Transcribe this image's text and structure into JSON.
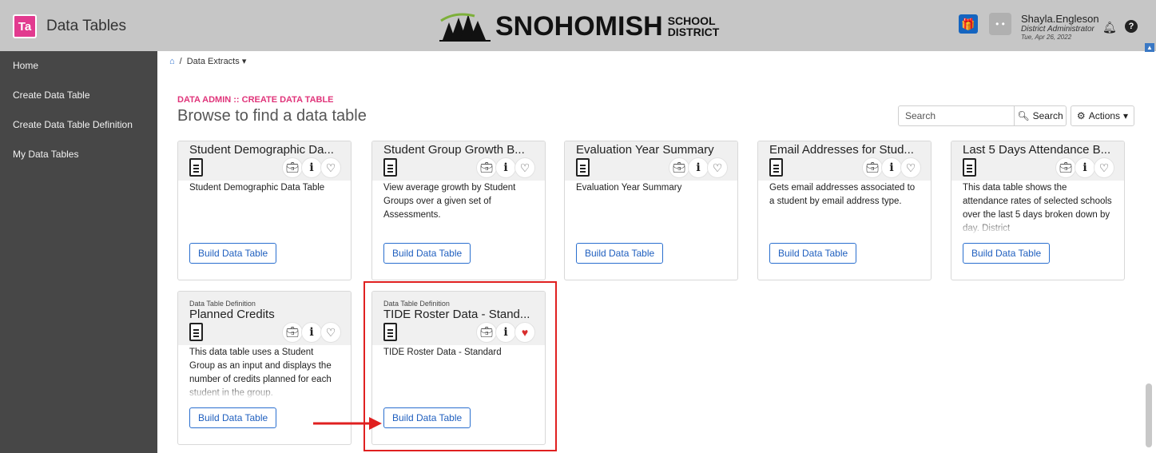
{
  "app": {
    "logo_text": "Ta",
    "name": "Data Tables"
  },
  "district": {
    "name": "SNOHOMISH",
    "line1": "SCHOOL",
    "line2": "DISTRICT"
  },
  "user": {
    "name": "Shayla.Engleson",
    "role": "District Administrator",
    "date": "Tue, Apr 26, 2022"
  },
  "sidebar": {
    "items": [
      {
        "label": "Home"
      },
      {
        "label": "Create Data Table"
      },
      {
        "label": "Create Data Table Definition"
      },
      {
        "label": "My Data Tables"
      }
    ]
  },
  "breadcrumb": {
    "separator": "/",
    "current": "Data Extracts",
    "caret": "▾"
  },
  "page": {
    "kicker": "DATA ADMIN :: CREATE DATA TABLE",
    "title": "Browse to find a data table"
  },
  "search": {
    "placeholder": "Search",
    "button_label": "Search"
  },
  "actions": {
    "label": "Actions"
  },
  "build_label": "Build Data Table",
  "cards": [
    {
      "type": "",
      "title": "Student Demographic Da...",
      "description": "Student Demographic Data Table",
      "favorite": false
    },
    {
      "type": "",
      "title": "Student Group Growth B...",
      "description": "View average growth by Student Groups over a given set of Assessments.",
      "favorite": false
    },
    {
      "type": "",
      "title": "Evaluation Year Summary",
      "description": "Evaluation Year Summary",
      "favorite": false
    },
    {
      "type": "",
      "title": "Email Addresses for Stud...",
      "description": "Gets email addresses associated to a student by email address type.",
      "favorite": false
    },
    {
      "type": "",
      "title": "Last 5 Days Attendance B...",
      "description": "This data table shows the attendance rates of selected schools over the last 5 days broken down by day. District",
      "favorite": false
    },
    {
      "type": "Data Table Definition",
      "title": "Planned Credits",
      "description": "This data table uses a Student Group as an input and displays the number of credits planned for each student in the group.",
      "favorite": false
    },
    {
      "type": "Data Table Definition",
      "title": "TIDE Roster Data - Stand...",
      "description": "TIDE Roster Data - Standard",
      "favorite": true
    }
  ],
  "colors": {
    "accent": "#e0347a",
    "sidebar": "#474747",
    "topbar": "#c6c6c6",
    "link": "#2a6fcf",
    "highlight": "#e02020"
  }
}
